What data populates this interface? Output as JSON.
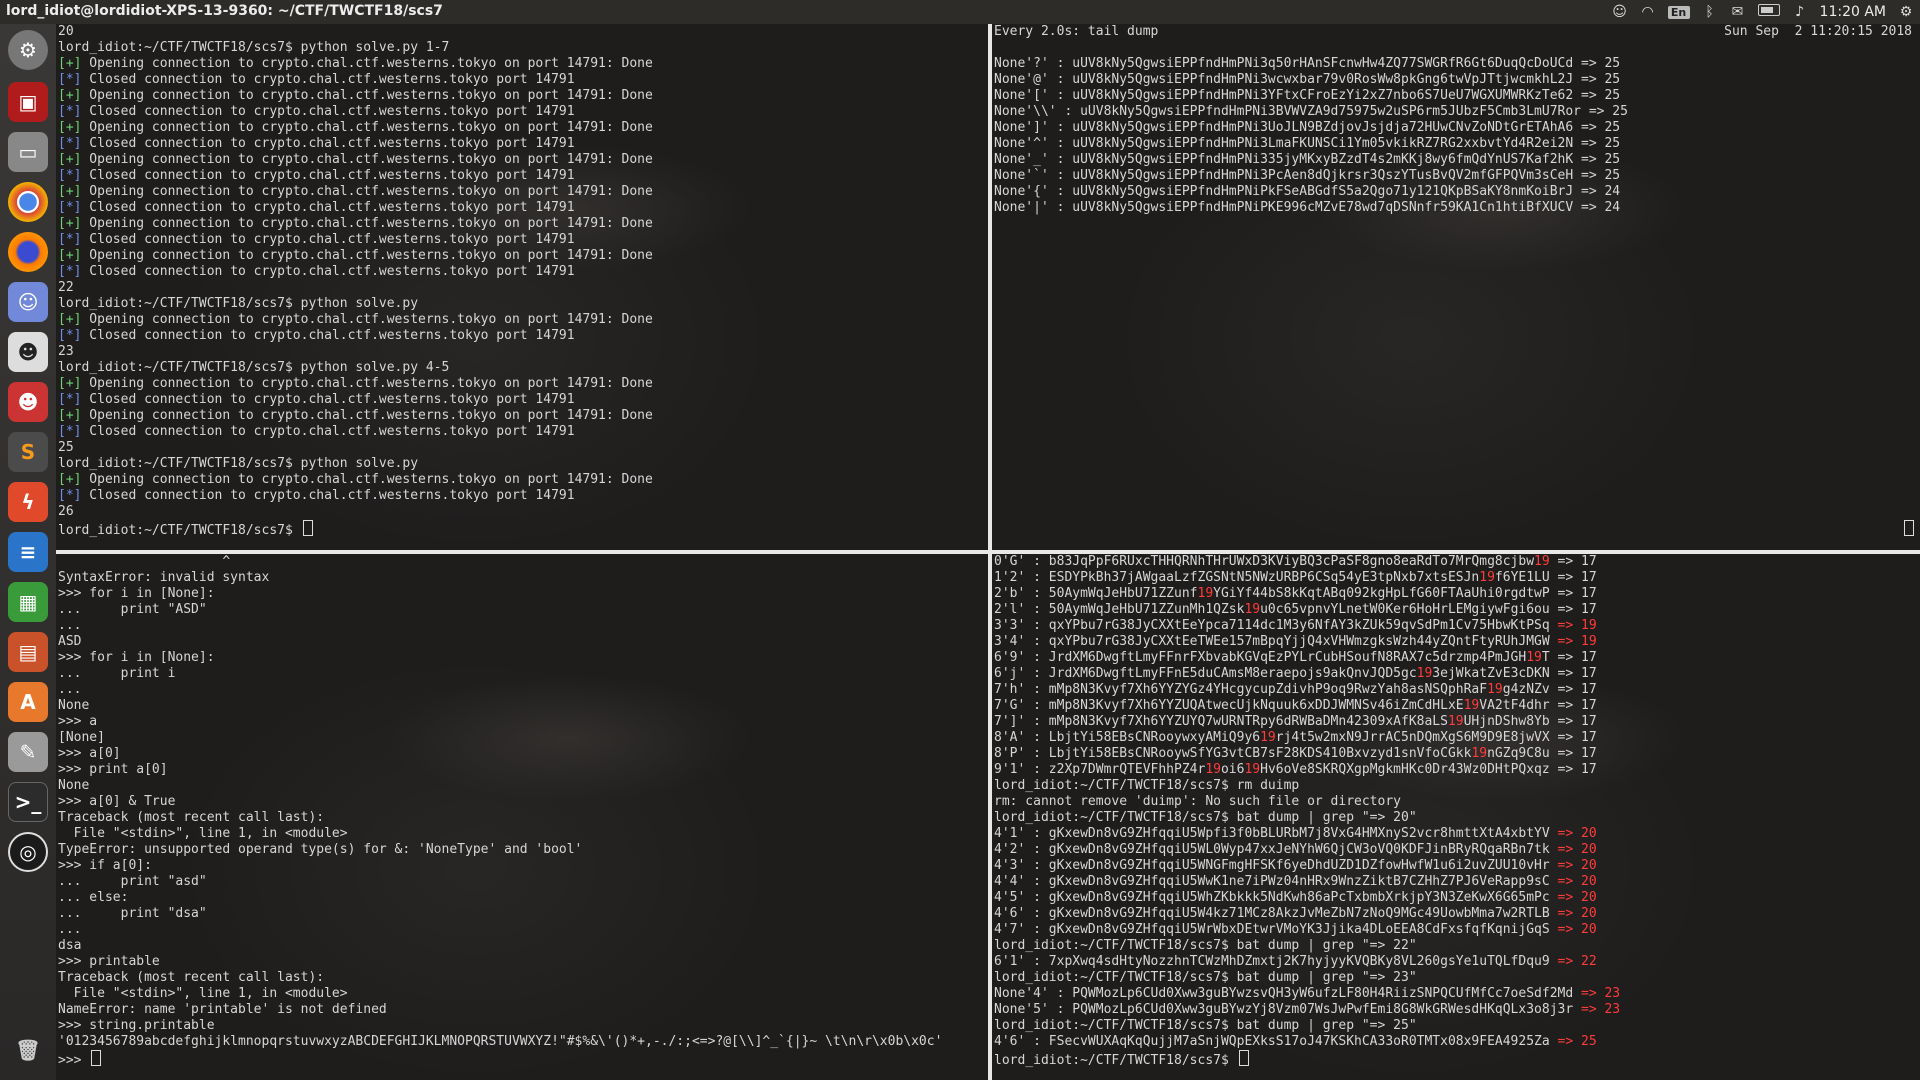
{
  "window": {
    "title": "lord_idiot@lordidiot-XPS-13-9360: ~/CTF/TWCTF18/scs7"
  },
  "tray": {
    "lang": "En",
    "time": "11:20 AM"
  },
  "launcher": {
    "items": [
      "system-settings",
      "terminal-app",
      "files",
      "chrome",
      "firefox",
      "discord",
      "avatar-1",
      "avatar-2",
      "sublime-text",
      "ida",
      "writer",
      "calc",
      "impress",
      "software-center",
      "tools",
      "terminal-2",
      "steam"
    ],
    "trash": "trash"
  },
  "panes": {
    "top_left": {
      "lines": [
        {
          "t": "20"
        },
        {
          "t": "lord_idiot:~/CTF/TWCTF18/scs7$ python solve.py 1-7"
        },
        {
          "p": "[+]",
          "c": "ok",
          "t": " Opening connection to crypto.chal.ctf.westerns.tokyo on port 14791: Done"
        },
        {
          "p": "[*]",
          "c": "info",
          "t": " Closed connection to crypto.chal.ctf.westerns.tokyo port 14791"
        },
        {
          "p": "[+]",
          "c": "ok",
          "t": " Opening connection to crypto.chal.ctf.westerns.tokyo on port 14791: Done"
        },
        {
          "p": "[*]",
          "c": "info",
          "t": " Closed connection to crypto.chal.ctf.westerns.tokyo port 14791"
        },
        {
          "p": "[+]",
          "c": "ok",
          "t": " Opening connection to crypto.chal.ctf.westerns.tokyo on port 14791: Done"
        },
        {
          "p": "[*]",
          "c": "info",
          "t": " Closed connection to crypto.chal.ctf.westerns.tokyo port 14791"
        },
        {
          "p": "[+]",
          "c": "ok",
          "t": " Opening connection to crypto.chal.ctf.westerns.tokyo on port 14791: Done"
        },
        {
          "p": "[*]",
          "c": "info",
          "t": " Closed connection to crypto.chal.ctf.westerns.tokyo port 14791"
        },
        {
          "p": "[+]",
          "c": "ok",
          "t": " Opening connection to crypto.chal.ctf.westerns.tokyo on port 14791: Done"
        },
        {
          "p": "[*]",
          "c": "info",
          "t": " Closed connection to crypto.chal.ctf.westerns.tokyo port 14791"
        },
        {
          "p": "[+]",
          "c": "ok",
          "t": " Opening connection to crypto.chal.ctf.westerns.tokyo on port 14791: Done"
        },
        {
          "p": "[*]",
          "c": "info",
          "t": " Closed connection to crypto.chal.ctf.westerns.tokyo port 14791"
        },
        {
          "p": "[+]",
          "c": "ok",
          "t": " Opening connection to crypto.chal.ctf.westerns.tokyo on port 14791: Done"
        },
        {
          "p": "[*]",
          "c": "info",
          "t": " Closed connection to crypto.chal.ctf.westerns.tokyo port 14791"
        },
        {
          "t": "22"
        },
        {
          "t": "lord_idiot:~/CTF/TWCTF18/scs7$ python solve.py"
        },
        {
          "p": "[+]",
          "c": "ok",
          "t": " Opening connection to crypto.chal.ctf.westerns.tokyo on port 14791: Done"
        },
        {
          "p": "[*]",
          "c": "info",
          "t": " Closed connection to crypto.chal.ctf.westerns.tokyo port 14791"
        },
        {
          "t": "23"
        },
        {
          "t": "lord_idiot:~/CTF/TWCTF18/scs7$ python solve.py 4-5"
        },
        {
          "p": "[+]",
          "c": "ok",
          "t": " Opening connection to crypto.chal.ctf.westerns.tokyo on port 14791: Done"
        },
        {
          "p": "[*]",
          "c": "info",
          "t": " Closed connection to crypto.chal.ctf.westerns.tokyo port 14791"
        },
        {
          "p": "[+]",
          "c": "ok",
          "t": " Opening connection to crypto.chal.ctf.westerns.tokyo on port 14791: Done"
        },
        {
          "p": "[*]",
          "c": "info",
          "t": " Closed connection to crypto.chal.ctf.westerns.tokyo port 14791"
        },
        {
          "t": "25"
        },
        {
          "t": "lord_idiot:~/CTF/TWCTF18/scs7$ python solve.py"
        },
        {
          "p": "[+]",
          "c": "ok",
          "t": " Opening connection to crypto.chal.ctf.westerns.tokyo on port 14791: Done"
        },
        {
          "p": "[*]",
          "c": "info",
          "t": " Closed connection to crypto.chal.ctf.westerns.tokyo port 14791"
        },
        {
          "t": "26"
        },
        {
          "t": "lord_idiot:~/CTF/TWCTF18/scs7$ ",
          "cursor": true
        }
      ]
    },
    "top_right": {
      "timestamp": "Sun Sep  2 11:20:15 2018",
      "lines": [
        {
          "t": "Every 2.0s: tail dump"
        },
        {
          "t": ""
        },
        {
          "t": "None'?' : uUV8kNy5QgwsiEPPfndHmPNi3q50rHAnSFcnwHw4ZQ77SWGRfR6Gt6DuqQcDoUCd => 25"
        },
        {
          "t": "None'@' : uUV8kNy5QgwsiEPPfndHmPNi3wcwxbar79v0RosWw8pkGng6twVpJTtjwcmkhL2J => 25"
        },
        {
          "t": "None'[' : uUV8kNy5QgwsiEPPfndHmPNi3YFtxCFroEzYi2xZ7nbo6S7UeU7WGXUMWRKzTe62 => 25"
        },
        {
          "t": "None'\\\\' : uUV8kNy5QgwsiEPPfndHmPNi3BVWVZA9d75975w2uSP6rm5JUbzF5Cmb3LmU7Ror => 25"
        },
        {
          "t": "None']' : uUV8kNy5QgwsiEPPfndHmPNi3UoJLN9BZdjovJsjdja72HUwCNvZoNDtGrETAhA6 => 25"
        },
        {
          "t": "None'^' : uUV8kNy5QgwsiEPPfndHmPNi3LmaFKUNSCi1Ym05vkikRZ7RG2xxbvtYd4R2ei2N => 25"
        },
        {
          "t": "None'_' : uUV8kNy5QgwsiEPPfndHmPNi335jyMKxyBZzdT4s2mKKj8wy6fmQdYnUS7Kaf2hK => 25"
        },
        {
          "t": "None'`' : uUV8kNy5QgwsiEPPfndHmPNi3PcAen8dQjkrsr3QszYTusBvQV2mfGFPQVm3sCeH => 25"
        },
        {
          "t": "None'{' : uUV8kNy5QgwsiEPPfndHmPNiPkFSeABGdfS5a2Qgo71y121QKpBSaKY8nmKoiBrJ => 24"
        },
        {
          "t": "None'|' : uUV8kNy5QgwsiEPPfndHmPNiPKE996cMZvE78wd7qDSNnfr59KA1Cn1htiBfXUCV => 24"
        }
      ]
    },
    "bottom_left": {
      "lines": [
        {
          "t": "                     ^"
        },
        {
          "t": "SyntaxError: invalid syntax"
        },
        {
          "t": ">>> for i in [None]:"
        },
        {
          "t": "...     print \"ASD\""
        },
        {
          "t": "..."
        },
        {
          "t": "ASD"
        },
        {
          "t": ">>> for i in [None]:"
        },
        {
          "t": "...     print i"
        },
        {
          "t": "..."
        },
        {
          "t": "None"
        },
        {
          "t": ">>> a"
        },
        {
          "t": "[None]"
        },
        {
          "t": ">>> a[0]"
        },
        {
          "t": ">>> print a[0]"
        },
        {
          "t": "None"
        },
        {
          "t": ">>> a[0] & True"
        },
        {
          "t": "Traceback (most recent call last):"
        },
        {
          "t": "  File \"<stdin>\", line 1, in <module>"
        },
        {
          "t": "TypeError: unsupported operand type(s) for &: 'NoneType' and 'bool'"
        },
        {
          "t": ">>> if a[0]:"
        },
        {
          "t": "...     print \"asd\""
        },
        {
          "t": "... else:"
        },
        {
          "t": "...     print \"dsa\""
        },
        {
          "t": "..."
        },
        {
          "t": "dsa"
        },
        {
          "t": ">>> printable"
        },
        {
          "t": "Traceback (most recent call last):"
        },
        {
          "t": "  File \"<stdin>\", line 1, in <module>"
        },
        {
          "t": "NameError: name 'printable' is not defined"
        },
        {
          "t": ">>> string.printable"
        },
        {
          "t": "'0123456789abcdefghijklmnopqrstuvwxyzABCDEFGHIJKLMNOPQRSTUVWXYZ!\"#$%&\\'()*+,-./:;<=>?@[\\\\]^_`{|}~ \\t\\n\\r\\x0b\\x0c'"
        },
        {
          "t": ">>> ",
          "cursor": true
        }
      ]
    },
    "bottom_right": {
      "lines": [
        {
          "s": [
            {
              "t": "0'G' : b83JqPpF6RUxcTHHQRNhTHrUWxD3KViyBQ3cPaSF8gno8eaRdTo7MrQmg8cjbw"
            },
            {
              "t": "19",
              "c": "red"
            },
            {
              "t": " => 17"
            }
          ]
        },
        {
          "s": [
            {
              "t": "1'2' : ESDYPkBh37jAWgaaLzfZGSNtN5NWzURBP6CSq54yE3tpNxb7xtsESJn"
            },
            {
              "t": "19",
              "c": "red"
            },
            {
              "t": "f6YE1LU => 17"
            }
          ]
        },
        {
          "s": [
            {
              "t": "2'b' : 50AymWqJeHbU71ZZunf"
            },
            {
              "t": "19",
              "c": "red"
            },
            {
              "t": "YGiYf44bS8kKqtABq092kgHpLfG60FTAaUhi0rgdtwP => 17"
            }
          ]
        },
        {
          "s": [
            {
              "t": "2'l' : 50AymWqJeHbU71ZZunMh1QZsk"
            },
            {
              "t": "19",
              "c": "red"
            },
            {
              "t": "u0c65vpnvYLnetW0Ker6HoHrLEMgiywFgi6ou => 17"
            }
          ]
        },
        {
          "s": [
            {
              "t": "3'3' : qxYPbu7rG38JyCXXtEeYpca7114dc1M3y6NfAY3kZUk59qvSdPm1Cv75HbwKtPSq "
            },
            {
              "t": "=> 19",
              "c": "red"
            }
          ]
        },
        {
          "s": [
            {
              "t": "3'4' : qxYPbu7rG38JyCXXtEeTWEe157mBpqYjjQ4xVHWmzgksWzh44yZQntFtyRUhJMGW "
            },
            {
              "t": "=> 19",
              "c": "red"
            }
          ]
        },
        {
          "s": [
            {
              "t": "6'9' : JrdXM6DwgftLmyFFnrFXbvabKGVqEzPYLrCubHSoufN8RAX7c5drzmp4PmJGH"
            },
            {
              "t": "19",
              "c": "red"
            },
            {
              "t": "T => 17"
            }
          ]
        },
        {
          "s": [
            {
              "t": "6'j' : JrdXM6DwgftLmyFFnE5duCAmsM8eraepojs9akQnvJQD5gc"
            },
            {
              "t": "19",
              "c": "red"
            },
            {
              "t": "3ejWkatZvE3cDKN => 17"
            }
          ]
        },
        {
          "s": [
            {
              "t": "7'h' : mMp8N3Kvyf7Xh6YYZYGz4YHcgycupZdivhP9oq9RwzYah8asNSQphRaF"
            },
            {
              "t": "19",
              "c": "red"
            },
            {
              "t": "g4zNZv => 17"
            }
          ]
        },
        {
          "s": [
            {
              "t": "7'G' : mMp8N3Kvyf7Xh6YYZUQAtwecUjkNquuk6xDDJWMNSv46iZmCdHLxE"
            },
            {
              "t": "19",
              "c": "red"
            },
            {
              "t": "VA2tF4dhr => 17"
            }
          ]
        },
        {
          "s": [
            {
              "t": "7']' : mMp8N3Kvyf7Xh6YYZUYQ7wURNTRpy6dRWBaDMn42309xAfK8aLS"
            },
            {
              "t": "19",
              "c": "red"
            },
            {
              "t": "UHjnDShw8Yb => 17"
            }
          ]
        },
        {
          "s": [
            {
              "t": "8'A' : LbjtYi58EBsCNRooywxyAMiQ9y6"
            },
            {
              "t": "19",
              "c": "red"
            },
            {
              "t": "rj4t5w2mxN9JrrAC5nDQmXgS6M9D9E8jwVX => 17"
            }
          ]
        },
        {
          "s": [
            {
              "t": "8'P' : LbjtYi58EBsCNRooywSfYG3vtCB7sF28KDS410Bxvzyd1snVfoCGkk"
            },
            {
              "t": "19",
              "c": "red"
            },
            {
              "t": "nGZq9C8u => 17"
            }
          ]
        },
        {
          "s": [
            {
              "t": "9'1' : z2Xp7DWmrQTEVFhhPZ4r"
            },
            {
              "t": "19",
              "c": "red"
            },
            {
              "t": "oi6"
            },
            {
              "t": "19",
              "c": "red"
            },
            {
              "t": "Hv6oVe8SKRQXgpMgkmHKc0Dr43Wz0DHtPQxqz => 17"
            }
          ]
        },
        {
          "s": [
            {
              "t": "lord_idiot:~/CTF/TWCTF18/scs7$ rm duimp"
            }
          ]
        },
        {
          "s": [
            {
              "t": "rm: cannot remove 'duimp': No such file or directory"
            }
          ]
        },
        {
          "s": [
            {
              "t": "lord_idiot:~/CTF/TWCTF18/scs7$ bat dump | grep \"=> 20\""
            }
          ]
        },
        {
          "s": [
            {
              "t": "4'1' : gKxewDn8vG9ZHfqqiU5Wpfi3f0bBLURbM7j8VxG4HMXnyS2vcr8hmttXtA4xbtYV "
            },
            {
              "t": "=> 20",
              "c": "red"
            }
          ]
        },
        {
          "s": [
            {
              "t": "4'2' : gKxewDn8vG9ZHfqqiU5WL0Wyp47xxJeNYhW6QjCW3oVQ0KDFJinBRyRQqaRBn7tk "
            },
            {
              "t": "=> 20",
              "c": "red"
            }
          ]
        },
        {
          "s": [
            {
              "t": "4'3' : gKxewDn8vG9ZHfqqiU5WNGFmgHFSKf6yeDhdUZD1DZfowHwfW1u6i2uvZUU10vHr "
            },
            {
              "t": "=> 20",
              "c": "red"
            }
          ]
        },
        {
          "s": [
            {
              "t": "4'4' : gKxewDn8vG9ZHfqqiU5WwK1ne7iPWz04nHRx9WnzZiktB7CZHhZ7PJ6VeRapp9sC "
            },
            {
              "t": "=> 20",
              "c": "red"
            }
          ]
        },
        {
          "s": [
            {
              "t": "4'5' : gKxewDn8vG9ZHfqqiU5WhZKbkkk5NdKwh86aPcTxbmbXrkjpY3N3ZeKwX6G65mPc "
            },
            {
              "t": "=> 20",
              "c": "red"
            }
          ]
        },
        {
          "s": [
            {
              "t": "4'6' : gKxewDn8vG9ZHfqqiU5W4kz71MCz8AkzJvMeZbN7zNoQ9MGc49UowbMma7w2RTLB "
            },
            {
              "t": "=> 20",
              "c": "red"
            }
          ]
        },
        {
          "s": [
            {
              "t": "4'7' : gKxewDn8vG9ZHfqqiU5WrWbxDEtwrVMoYK3Jjika4DLoEEA8CdFxsfqfKqnijGqS "
            },
            {
              "t": "=> 20",
              "c": "red"
            }
          ]
        },
        {
          "s": [
            {
              "t": "lord_idiot:~/CTF/TWCTF18/scs7$ bat dump | grep \"=> 22\""
            }
          ]
        },
        {
          "s": [
            {
              "t": "6'1' : 7xpXwq4sdHtyNozzhnTCWzMhDZmxtj2K7hyjyyKVQBKy8VL260gsYe1uTQLfDqu9 "
            },
            {
              "t": "=> 22",
              "c": "red"
            }
          ]
        },
        {
          "s": [
            {
              "t": "lord_idiot:~/CTF/TWCTF18/scs7$ bat dump | grep \"=> 23\""
            }
          ]
        },
        {
          "s": [
            {
              "t": "None'4' : PQWMozLp6CUd0Xww3guBYwzsvQH3yW6ufzLF80H4RiizSNPQCUfMfCc7oeSdf2Md "
            },
            {
              "t": "=> 23",
              "c": "red"
            }
          ]
        },
        {
          "s": [
            {
              "t": "None'5' : PQWMozLp6CUd0Xww3guBYwzYj8Vzm07WsJwPwfEmi8G8WkGRWesdHKqQLx3o8j3r "
            },
            {
              "t": "=> 23",
              "c": "red"
            }
          ]
        },
        {
          "s": [
            {
              "t": "lord_idiot:~/CTF/TWCTF18/scs7$ bat dump | grep \"=> 25\""
            }
          ]
        },
        {
          "s": [
            {
              "t": "4'6' : FSecvWUXAqKqQujjM7aSnjWQpEXksS17oJ47KSKhCA33oR0TMTx08x9FEA4925Za "
            },
            {
              "t": "=> 25",
              "c": "red"
            }
          ]
        },
        {
          "s": [
            {
              "t": "lord_idiot:~/CTF/TWCTF18/scs7$ "
            }
          ],
          "cursor": true
        }
      ]
    }
  }
}
